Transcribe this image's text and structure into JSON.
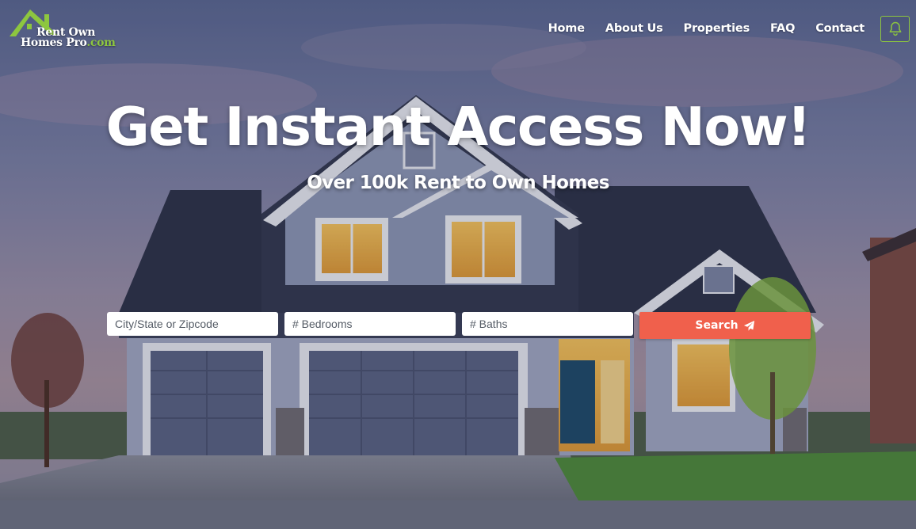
{
  "brand": {
    "line1": "Rent Own",
    "line2_main": "Homes Pro",
    "line2_suffix": ".com",
    "accent_color": "#8dc63f"
  },
  "nav": {
    "items": [
      {
        "label": "Home"
      },
      {
        "label": "About Us"
      },
      {
        "label": "Properties"
      },
      {
        "label": "FAQ"
      },
      {
        "label": "Contact"
      }
    ],
    "bell_icon": "bell-icon"
  },
  "hero": {
    "title": "Get Instant Access Now!",
    "subtitle": "Over 100k Rent to Own Homes"
  },
  "search": {
    "location_placeholder": "City/State or Zipcode",
    "location_value": "",
    "bedrooms_placeholder": "# Bedrooms",
    "bedrooms_value": "",
    "baths_placeholder": "# Baths",
    "baths_value": "",
    "button_label": "Search",
    "button_icon": "paper-plane-icon",
    "button_color": "#f0604c"
  }
}
